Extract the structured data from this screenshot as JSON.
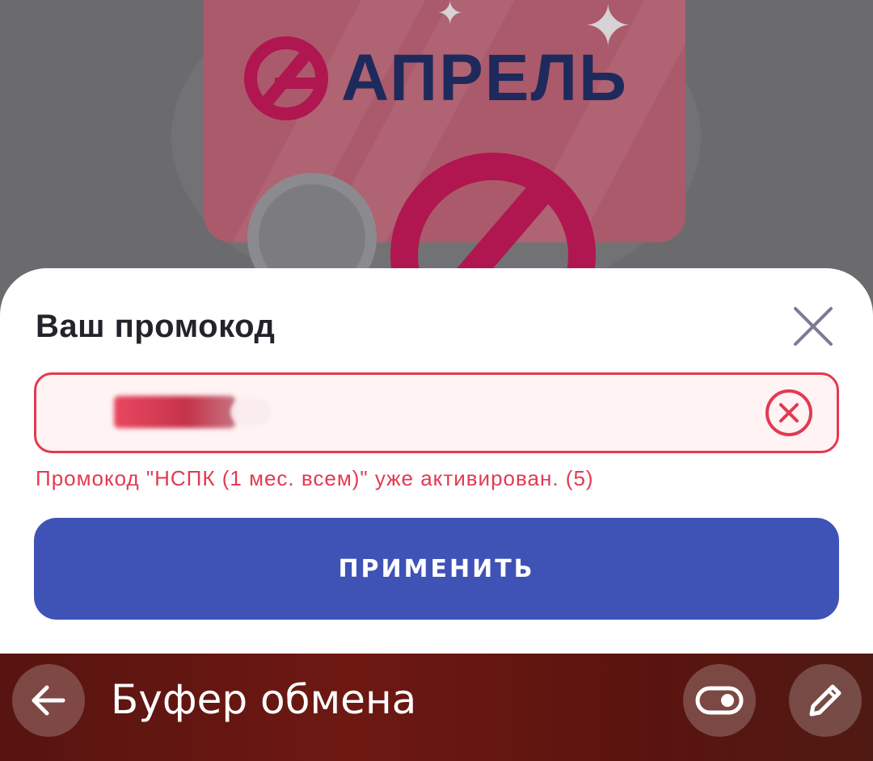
{
  "background": {
    "brand_logo_text": "АПРЕЛЬ",
    "colors": {
      "card": "#ab5a6b",
      "logo_mark": "#b0164f",
      "logo_text": "#1f2a5c"
    }
  },
  "sheet": {
    "title": "Ваш промокод",
    "close_icon": "close-icon",
    "promo_input": {
      "placeholder": "",
      "state": "error"
    },
    "clear_icon": "clear-circle-icon",
    "error_message": "Промокод \"НСПК (1 мес. всем)\" уже активирован. (5)",
    "apply_button_label": "Применить",
    "colors": {
      "error": "#e23a52",
      "primary_button": "#3f52b6"
    }
  },
  "clipboard_bar": {
    "title": "Буфер обмена",
    "back_icon": "back-arrow-icon",
    "toggle_icon": "toggle-icon",
    "edit_icon": "pencil-icon",
    "colors": {
      "bar": "#6e1812"
    }
  }
}
